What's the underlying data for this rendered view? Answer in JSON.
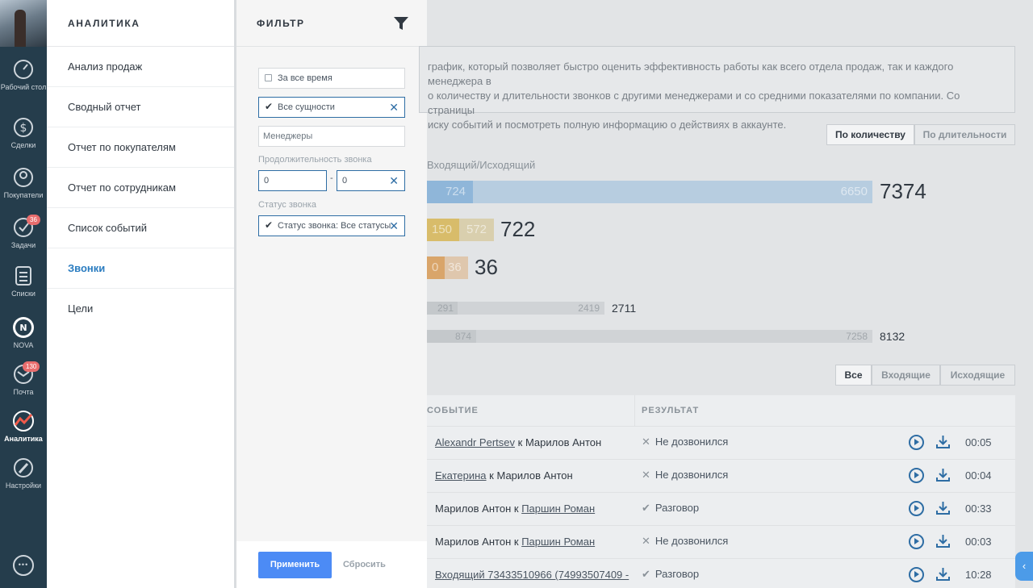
{
  "nav": {
    "items": [
      {
        "label": "Рабочий стол",
        "icon": "dashboard-icon"
      },
      {
        "label": "Сделки",
        "icon": "dollar-icon"
      },
      {
        "label": "Покупатели",
        "icon": "buyers-icon"
      },
      {
        "label": "Задачи",
        "icon": "tasks-icon",
        "badge": "36"
      },
      {
        "label": "Списки",
        "icon": "lists-icon"
      },
      {
        "label": "NOVA",
        "icon": "nova-icon"
      },
      {
        "label": "Почта",
        "icon": "mail-icon",
        "badge": "130"
      },
      {
        "label": "Аналитика",
        "icon": "analytics-icon"
      },
      {
        "label": "Настройки",
        "icon": "settings-icon"
      }
    ]
  },
  "menu": {
    "title": "АНАЛИТИКА",
    "items": [
      "Анализ продаж",
      "Сводный отчет",
      "Отчет по покупателям",
      "Отчет по сотрудникам",
      "Список событий",
      "Звонки",
      "Цели"
    ],
    "active": "Звонки"
  },
  "filter": {
    "title": "ФИЛЬТР",
    "period": "За все время",
    "entities": "Все сущности",
    "managers_placeholder": "Менеджеры",
    "duration_label": "Продолжительность звонка",
    "duration_from": "0",
    "duration_to": "0",
    "status_label": "Статус звонка",
    "status_value": "Статус звонка: Все статусы",
    "apply": "Применить",
    "reset": "Сбросить"
  },
  "background": {
    "info_lines": [
      "график, который позволяет быстро оценить эффективность работы как всего отдела продаж, так и каждого менеджера в",
      "о количеству и длительности звонков с другими менеджерами и со средними показателями по компании. Со страницы",
      "иску событий и посмотреть полную информацию о действиях в аккаунте."
    ],
    "toggle": [
      "По количеству",
      "По длительности"
    ],
    "caption": "Входящий/Исходящий",
    "stats": [
      {
        "a": "724",
        "b": "6650",
        "total": "7374"
      },
      {
        "a": "150",
        "b": "572",
        "total": "722"
      },
      {
        "a": "0",
        "b": "36",
        "total": "36"
      },
      {
        "a": "291",
        "b": "2419",
        "total": "2711"
      },
      {
        "a": "874",
        "b": "7258",
        "total": "8132"
      }
    ],
    "tabs": [
      "Все",
      "Входящие",
      "Исходящие"
    ],
    "columns": [
      "СОБЫТИЕ",
      "РЕЗУЛЬТАТ"
    ],
    "rows": [
      {
        "from": "Alexandr Pertsev",
        "from_link": true,
        "to": "Марилов Антон",
        "to_link": false,
        "result": "Не дозвонился",
        "ok": false,
        "dur": "00:05"
      },
      {
        "from": "Екатерина",
        "from_link": true,
        "to": "Марилов Антон",
        "to_link": false,
        "result": "Не дозвонился",
        "ok": false,
        "dur": "00:04"
      },
      {
        "from": "Марилов Антон",
        "from_link": false,
        "to": "Паршин Роман",
        "to_link": true,
        "result": "Разговор",
        "ok": true,
        "dur": "00:33"
      },
      {
        "from": "Марилов Антон",
        "from_link": false,
        "to": "Паршин Роман",
        "to_link": true,
        "result": "Не дозвонился",
        "ok": false,
        "dur": "00:03"
      },
      {
        "from": "Входящий 73433510966 (74993507409 -",
        "from_link": true,
        "to": "",
        "to_link": false,
        "result": "Разговор",
        "ok": true,
        "dur": "10:28"
      }
    ],
    "connector": "к"
  },
  "colors": {
    "accent": "#4c8bf5",
    "active_link": "#2a7cc0",
    "nav_bg": "#253d4c"
  }
}
